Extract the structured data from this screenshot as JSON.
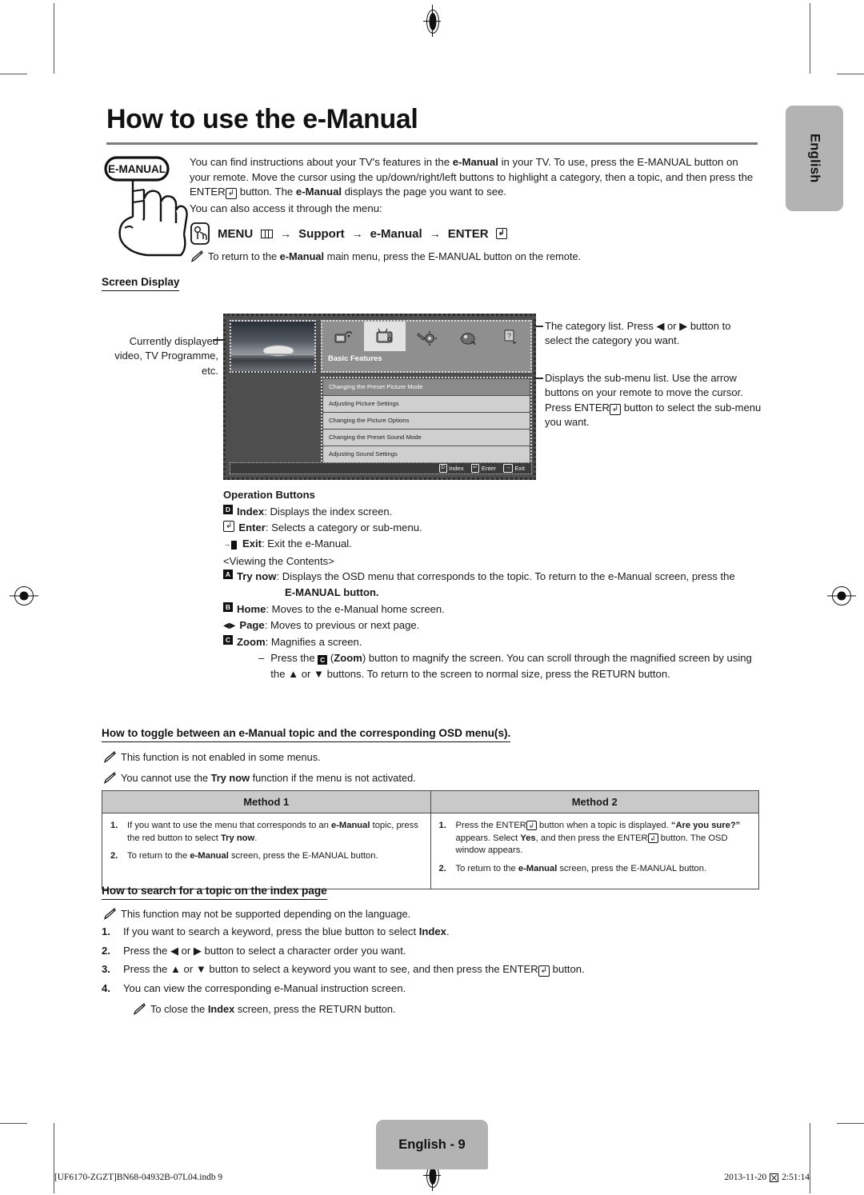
{
  "page": {
    "title": "How to use the e-Manual",
    "language_tab": "English",
    "page_badge": "English -  9",
    "footer_left": "[UF6170-ZGZT]BN68-04932B-07L04.indb   9",
    "footer_date": "2013-11-20",
    "footer_time": "2:51:14"
  },
  "intro": {
    "icon_label": "E-MANUAL",
    "paragraph_1_a": "You can find instructions about your TV's features in the ",
    "paragraph_1_b": "e-Manual",
    "paragraph_1_c": " in your TV. To use, press the E-MANUAL button on your remote. Move the cursor using the up/down/right/left buttons to highlight a category, then a topic, and then press the ENTER",
    "paragraph_1_d": " button. The ",
    "paragraph_1_e": "e-Manual",
    "paragraph_1_f": " displays the page you want to see.",
    "paragraph_2": "You can also access it through the menu:",
    "menu_path": {
      "menu": "MENU",
      "arrow": "→",
      "support": "Support",
      "emanual": "e-Manual",
      "enter": "ENTER"
    },
    "note": {
      "a": "To return to the ",
      "b": "e-Manual",
      "c": " main menu, press the E-MANUAL button on the remote."
    }
  },
  "sections": {
    "screen_display": "Screen Display",
    "toggle": "How to toggle between an e-Manual topic and the corresponding OSD menu(s).",
    "search": "How to search for a topic on the index page"
  },
  "tv_screen": {
    "category_label": "Basic Features",
    "categories": [
      "network-icon",
      "tv-picture-icon",
      "tools-settings-icon",
      "support-camera-icon",
      "help-question-icon"
    ],
    "active_category_index": 1,
    "submenu_items": [
      "Changing the Preset Picture Mode",
      "Adjusting Picture Settings",
      "Changing the Picture Options",
      "Changing the Preset Sound Mode",
      "Adjusting Sound Settings"
    ],
    "selected_submenu_index": 0,
    "status_bar": [
      {
        "key": "D",
        "label": "Index"
      },
      {
        "key": "↵",
        "label": "Enter"
      },
      {
        "key": "→",
        "label": "Exit"
      }
    ]
  },
  "callouts": {
    "left": "Currently displayed video, TV Programme, etc.",
    "right_1": "The category list. Press ◀ or ▶ button to select the category you want.",
    "right_2_a": "Displays the sub-menu list. Use the arrow buttons on your remote to move the cursor. Press ENTER",
    "right_2_b": " button to select the sub-menu you want."
  },
  "operation_buttons": {
    "title": "Operation Buttons",
    "items": [
      {
        "icon": "index-key-icon",
        "key": "D",
        "name": "Index",
        "text": ": Displays the index screen."
      },
      {
        "icon": "enter-key-icon",
        "key": "↵",
        "name": "Enter",
        "text": ": Selects a category or sub-menu."
      },
      {
        "icon": "exit-key-icon",
        "key": "→",
        "name": "Exit",
        "text": ": Exit the e-Manual."
      }
    ],
    "viewing_contents": "<Viewing the Contents>",
    "try_now": {
      "key": "A",
      "name": "Try now",
      "text": ": Displays the OSD menu that corresponds to the topic. To return to the e-Manual screen, press the",
      "line2": "E-MANUAL button."
    },
    "home": {
      "key": "B",
      "name": "Home",
      "text": ": Moves to the e-Manual home screen."
    },
    "page": {
      "key": "◀▶",
      "name": "Page",
      "text": ": Moves to previous or next page."
    },
    "zoom": {
      "key": "C",
      "name": "Zoom",
      "text": ": Magnifies a screen."
    },
    "zoom_detail": {
      "dash": "–",
      "a": "Press the ",
      "key": "C",
      "b": " (",
      "bold": "Zoom",
      "c": ") button to magnify the screen. You can scroll through the magnified screen by using the ▲ or ▼ buttons. To return to the screen to normal size, press the RETURN button."
    }
  },
  "toggle_notes": {
    "note_1": "This function is not enabled in some menus.",
    "note_2_a": "You cannot use the ",
    "note_2_b": "Try now",
    "note_2_c": " function if the menu is not activated."
  },
  "method_table": {
    "headers": [
      "Method 1",
      "Method 2"
    ],
    "method_1": [
      {
        "num": "1.",
        "a": "If you want to use the menu that corresponds to an ",
        "b": "e-Manual",
        "c": " topic, press the red button to select ",
        "d": "Try now",
        "e": "."
      },
      {
        "num": "2.",
        "a": "To return to the ",
        "b": "e-Manual",
        "c": " screen, press the E-MANUAL button.",
        "d": "",
        "e": ""
      }
    ],
    "method_2": [
      {
        "num": "1.",
        "a": "Press the ENTER",
        "b": " button when a topic is displayed. ",
        "c": "“Are you sure?”",
        "d": " appears. Select ",
        "e": "Yes",
        "f": ", and then press the ENTER",
        "g": " button. The OSD window appears."
      },
      {
        "num": "2.",
        "a": "To return to the ",
        "b": "e-Manual",
        "c": " screen, press the E-MANUAL button.",
        "d": "",
        "e": "",
        "f": "",
        "g": ""
      }
    ]
  },
  "search_section": {
    "note_1": "This function may not be supported depending on the language.",
    "steps": [
      {
        "num": "1.",
        "a": "If you want to search a keyword, press the blue button to select ",
        "b": "Index",
        "c": "."
      },
      {
        "num": "2.",
        "a": "Press the ◀ or ▶ button to select a character order you want.",
        "b": "",
        "c": ""
      },
      {
        "num": "3.",
        "a": "Press the ▲ or ▼ button to select a keyword you want to see, and then press the ENTER",
        "b": "",
        "c": " button."
      },
      {
        "num": "4.",
        "a": "You can view the corresponding e-Manual instruction screen.",
        "b": "",
        "c": ""
      }
    ],
    "note_2_a": "To close the ",
    "note_2_b": "Index",
    "note_2_c": " screen, press the RETURN button."
  },
  "colors": {
    "badge_gray": "#b3b3b3",
    "table_header_gray": "#c9c9c9",
    "tv_body": "#4e4e4e",
    "rule_gray": "#7d7d7d"
  }
}
